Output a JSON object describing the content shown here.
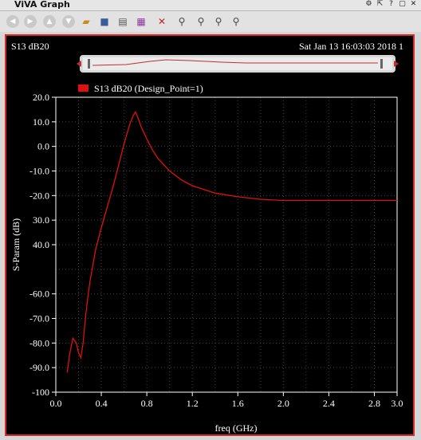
{
  "window": {
    "title": "ViVA Graph"
  },
  "toolbar": {
    "icons": [
      "back-icon",
      "forward-icon",
      "up-icon",
      "down-icon",
      "open-folder-icon",
      "save-icon",
      "print-icon",
      "calculator-icon",
      "delete-icon",
      "zoom-in-icon",
      "zoom-fit-icon",
      "zoom-x-icon",
      "zoom-y-icon"
    ]
  },
  "plot": {
    "title": "S13 dB20",
    "timestamp": "Sat Jan 13 16:03:03 2018  1",
    "legend": "S13 dB20 (Design_Point=1)",
    "colors": {
      "trace": "#e01010",
      "frame": "#d72b2b",
      "background": "#000000",
      "text": "#ffffff",
      "grid": "#404040"
    }
  },
  "chart_data": {
    "type": "line",
    "xlabel": "freq (GHz)",
    "ylabel": "S-Param (dB)",
    "xlim": [
      0.0,
      3.0
    ],
    "ylim": [
      -100,
      20
    ],
    "x_ticks": [
      "0.0",
      "0.4",
      "0.8",
      "1.2",
      "1.6",
      "2.0",
      "2.4",
      "2.8",
      "3.0"
    ],
    "x_tick_values": [
      0.0,
      0.4,
      0.8,
      1.2,
      1.6,
      2.0,
      2.4,
      2.8,
      3.0
    ],
    "y_ticks": [
      "20.0",
      "10.0",
      "0.0",
      "-10.0",
      "-20.0",
      "30.0",
      "40.0",
      "-60.0",
      "-70.0",
      "-80.0",
      "-90.0",
      "-100"
    ],
    "y_tick_values": [
      20,
      10,
      0,
      -10,
      -20,
      -30,
      -40,
      -60,
      -70,
      -80,
      -90,
      -100
    ],
    "grid": true,
    "legend_position": "top-left",
    "series": [
      {
        "name": "S13 dB20 (Design_Point=1)",
        "x": [
          0.1,
          0.12,
          0.15,
          0.18,
          0.2,
          0.22,
          0.24,
          0.26,
          0.28,
          0.3,
          0.35,
          0.4,
          0.45,
          0.5,
          0.55,
          0.6,
          0.65,
          0.68,
          0.7,
          0.72,
          0.75,
          0.8,
          0.85,
          0.9,
          1.0,
          1.1,
          1.2,
          1.4,
          1.6,
          1.8,
          2.0,
          2.2,
          2.5,
          3.0
        ],
        "y": [
          -92,
          -85,
          -78,
          -80,
          -84,
          -86,
          -80,
          -70,
          -62,
          -55,
          -42,
          -33,
          -25,
          -17,
          -8,
          1,
          9,
          12.5,
          14,
          12,
          8,
          3,
          -1.5,
          -5,
          -10,
          -13.5,
          -16,
          -19,
          -20.5,
          -21.5,
          -22,
          -22,
          -22,
          -22
        ]
      }
    ]
  }
}
